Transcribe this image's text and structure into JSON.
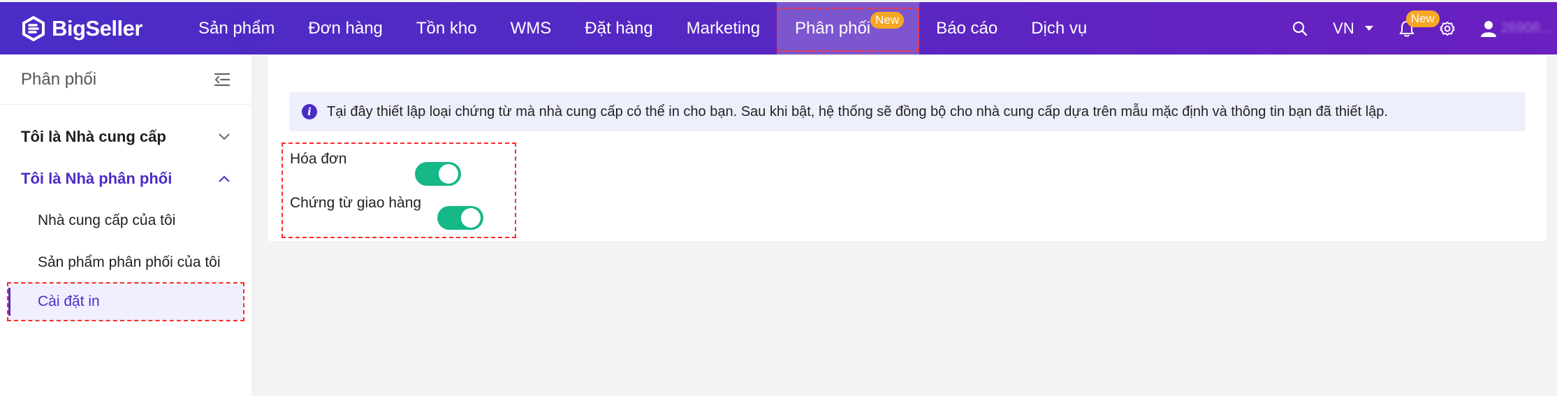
{
  "brand": {
    "name": "BigSeller"
  },
  "nav": {
    "items": [
      {
        "label": "Sản phẩm"
      },
      {
        "label": "Đơn hàng"
      },
      {
        "label": "Tồn kho"
      },
      {
        "label": "WMS"
      },
      {
        "label": "Đặt hàng"
      },
      {
        "label": "Marketing"
      },
      {
        "label": "Phân phối",
        "badge": "New",
        "active": true
      },
      {
        "label": "Báo cáo"
      },
      {
        "label": "Dịch vụ"
      }
    ]
  },
  "tools": {
    "search_icon": "search-icon",
    "language": "VN",
    "notification_badge": "New",
    "user_name": "26908..."
  },
  "sidebar": {
    "title": "Phân phối",
    "groups": [
      {
        "label": "Tôi là Nhà cung cấp",
        "expanded": false
      },
      {
        "label": "Tôi là Nhà phân phối",
        "expanded": true,
        "items": [
          {
            "label": "Nhà cung cấp của tôi"
          },
          {
            "label": "Sản phẩm phân phối của tôi"
          },
          {
            "label": "Cài đặt in",
            "active": true
          }
        ]
      }
    ]
  },
  "main": {
    "info_text": "Tại đây thiết lập loại chứng từ mà nhà cung cấp có thể in cho bạn. Sau khi bật, hệ thống sẽ đồng bộ cho nhà cung cấp dựa trên mẫu mặc định và thông tin bạn đã thiết lập.",
    "settings": [
      {
        "label": "Hóa đơn",
        "enabled": true
      },
      {
        "label": "Chứng từ giao hàng",
        "enabled": true
      }
    ]
  },
  "colors": {
    "accent": "#4b2cc7",
    "toggle_on": "#16b888",
    "badge": "#f6a623"
  }
}
